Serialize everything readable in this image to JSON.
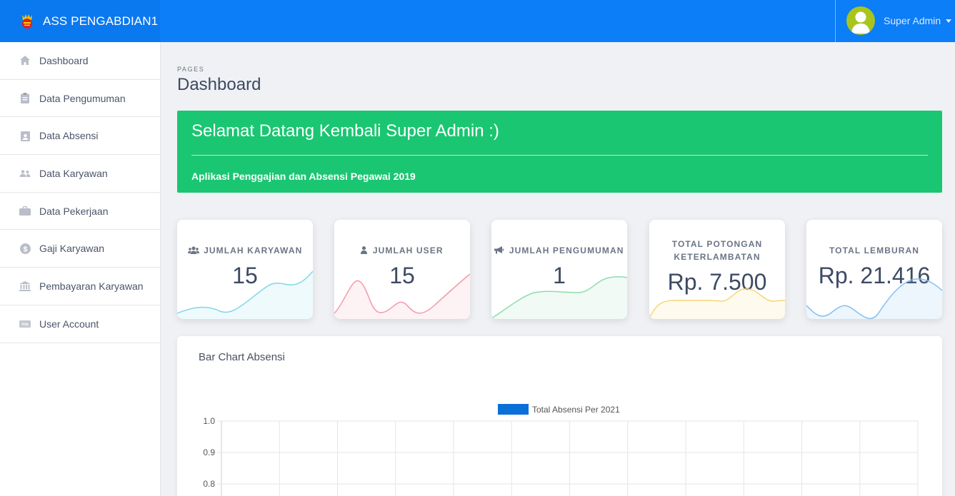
{
  "app": {
    "title": "ASS PENGABDIAN1"
  },
  "user": {
    "name": "Super Admin"
  },
  "sidebar": {
    "items": [
      {
        "label": "Dashboard",
        "icon": "home-icon"
      },
      {
        "label": "Data Pengumuman",
        "icon": "clipboard-icon"
      },
      {
        "label": "Data Absensi",
        "icon": "id-card-icon"
      },
      {
        "label": "Data Karyawan",
        "icon": "users-icon"
      },
      {
        "label": "Data Pekerjaan",
        "icon": "briefcase-icon"
      },
      {
        "label": "Gaji Karyawan",
        "icon": "dollar-icon"
      },
      {
        "label": "Pembayaran Karyawan",
        "icon": "bank-icon"
      },
      {
        "label": "User Account",
        "icon": "pin-icon"
      }
    ]
  },
  "page": {
    "breadcrumb": "PAGES",
    "title": "Dashboard"
  },
  "welcome": {
    "title": "Selamat Datang Kembali Super Admin :)",
    "subtitle": "Aplikasi Penggajian dan Absensi Pegawai 2019"
  },
  "stats": [
    {
      "label": "JUMLAH KARYAWAN",
      "value": "15",
      "icon": "users-icon",
      "color": "#7fd6ea"
    },
    {
      "label": "JUMLAH USER",
      "value": "15",
      "icon": "user-icon",
      "color": "#f29aaa"
    },
    {
      "label": "JUMLAH PENGUMUMAN",
      "value": "1",
      "icon": "bullhorn-icon",
      "color": "#8fdcae"
    },
    {
      "label_line1": "TOTAL POTONGAN",
      "label_line2": "KETERLAMBATAN",
      "value": "Rp. 7.500",
      "color": "#f6d774"
    },
    {
      "label": "TOTAL LEMBURAN",
      "value": "Rp. 21.416",
      "color": "#86bff0"
    }
  ],
  "colors": {
    "topbar": "#0b7ef8",
    "welcome": "#1ac671",
    "bar": "#0b6fd8"
  },
  "chart_data": {
    "type": "bar",
    "title": "Bar Chart Absensi",
    "series": [
      {
        "name": "Total Absensi Per 2021",
        "color": "#0b6fd8"
      }
    ],
    "y_ticks_visible": [
      "1.0",
      "0.9",
      "0.8"
    ],
    "ylim": [
      0,
      1.0
    ],
    "grid": true,
    "legend": "top-center"
  }
}
